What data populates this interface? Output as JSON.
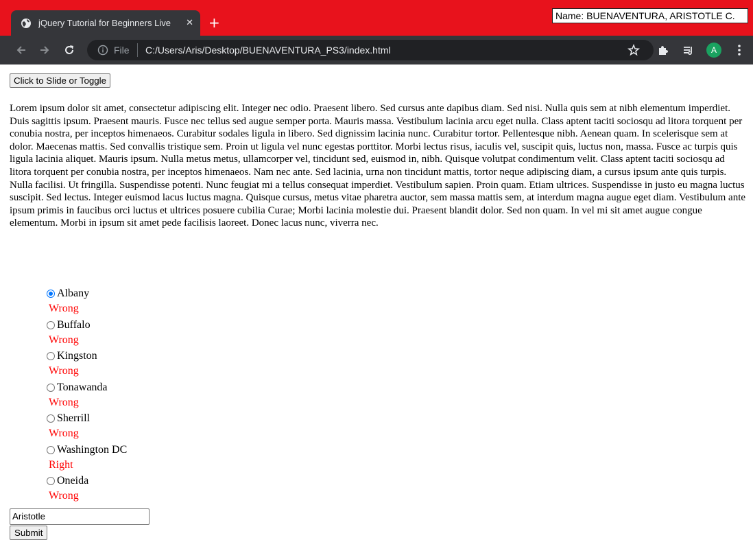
{
  "browser": {
    "tab_title": "jQuery Tutorial for Beginners Live",
    "tab_close": "✕",
    "new_tab": "+",
    "name_tag": "Name: BUENAVENTURA, ARISTOTLE C.",
    "omnibox_scheme": "File",
    "omnibox_url": "C:/Users/Aris/Desktop/BUENAVENTURA_PS3/index.html",
    "avatar_letter": "A",
    "colors": {
      "tabstrip": "#e8121c",
      "toolbar": "#35363a",
      "omnibox": "#202124",
      "avatar": "#1aa260"
    }
  },
  "page": {
    "slide_button": "Click to Slide or Toggle",
    "lorem": "Lorem ipsum dolor sit amet, consectetur adipiscing elit. Integer nec odio. Praesent libero. Sed cursus ante dapibus diam. Sed nisi. Nulla quis sem at nibh elementum imperdiet. Duis sagittis ipsum. Praesent mauris. Fusce nec tellus sed augue semper porta. Mauris massa. Vestibulum lacinia arcu eget nulla. Class aptent taciti sociosqu ad litora torquent per conubia nostra, per inceptos himenaeos. Curabitur sodales ligula in libero. Sed dignissim lacinia nunc. Curabitur tortor. Pellentesque nibh. Aenean quam. In scelerisque sem at dolor. Maecenas mattis. Sed convallis tristique sem. Proin ut ligula vel nunc egestas porttitor. Morbi lectus risus, iaculis vel, suscipit quis, luctus non, massa. Fusce ac turpis quis ligula lacinia aliquet. Mauris ipsum. Nulla metus metus, ullamcorper vel, tincidunt sed, euismod in, nibh. Quisque volutpat condimentum velit. Class aptent taciti sociosqu ad litora torquent per conubia nostra, per inceptos himenaeos. Nam nec ante. Sed lacinia, urna non tincidunt mattis, tortor neque adipiscing diam, a cursus ipsum ante quis turpis. Nulla facilisi. Ut fringilla. Suspendisse potenti. Nunc feugiat mi a tellus consequat imperdiet. Vestibulum sapien. Proin quam. Etiam ultrices. Suspendisse in justo eu magna luctus suscipit. Sed lectus. Integer euismod lacus luctus magna. Quisque cursus, metus vitae pharetra auctor, sem massa mattis sem, at interdum magna augue eget diam. Vestibulum ante ipsum primis in faucibus orci luctus et ultrices posuere cubilia Curae; Morbi lacinia molestie dui. Praesent blandit dolor. Sed non quam. In vel mi sit amet augue congue elementum. Morbi in ipsum sit amet pede facilisis laoreet. Donec lacus nunc, viverra nec.",
    "cities": [
      {
        "label": "Albany",
        "verdict": "Wrong",
        "checked": true
      },
      {
        "label": "Buffalo",
        "verdict": "Wrong",
        "checked": false
      },
      {
        "label": "Kingston",
        "verdict": "Wrong",
        "checked": false
      },
      {
        "label": "Tonawanda",
        "verdict": "Wrong",
        "checked": false
      },
      {
        "label": "Sherrill",
        "verdict": "Wrong",
        "checked": false
      },
      {
        "label": "Washington DC",
        "verdict": "Right",
        "checked": false
      },
      {
        "label": "Oneida",
        "verdict": "Wrong",
        "checked": false
      }
    ],
    "name_value": "Aristotle",
    "submit_button": "Submit",
    "verdict_color": "#ff0000",
    "radio_checked_color": "#0075ff"
  }
}
